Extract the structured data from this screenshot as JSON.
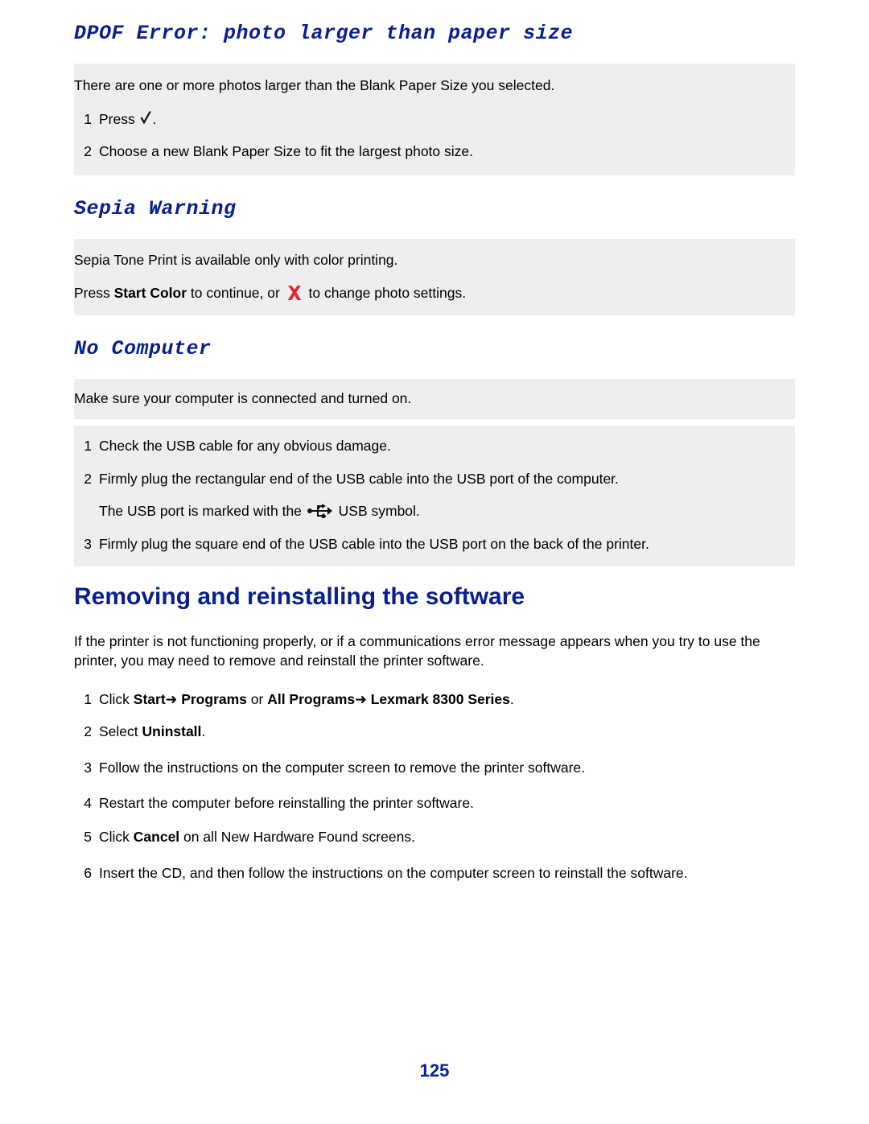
{
  "page": {
    "number": "125"
  },
  "sections": {
    "dpof": {
      "heading": "DPOF Error: photo larger than paper size",
      "intro": "There are one or more photos larger than the Blank Paper Size you selected.",
      "steps": [
        {
          "num": "1",
          "pre": "Press ",
          "post": "."
        },
        {
          "num": "2",
          "text": "Choose a new Blank Paper Size to fit the largest photo size."
        }
      ]
    },
    "sepia": {
      "heading": "Sepia Warning",
      "line1": "Sepia Tone Print is available only with color printing.",
      "line2_pre": "Press ",
      "line2_bold": "Start Color",
      "line2_mid": " to continue, or ",
      "line2_post": " to change photo settings."
    },
    "no_computer": {
      "heading": "No Computer",
      "intro": "Make sure your computer is connected and turned on.",
      "steps": [
        {
          "num": "1",
          "text": "Check the USB cable for any obvious damage."
        },
        {
          "num": "2",
          "text": "Firmly plug the rectangular end of the USB cable into the USB port of the computer."
        },
        {
          "num": "3",
          "text": "Firmly plug the square end of the USB cable into the USB port on the back of the printer."
        }
      ],
      "usb_note_pre": "The USB port is marked with the ",
      "usb_note_post": " USB symbol."
    },
    "removing": {
      "heading": "Removing and reinstalling the software",
      "intro": "If the printer is not functioning properly, or if a communications error message appears when you try to use the printer, you may need to remove and reinstall the printer software.",
      "step1": {
        "num": "1",
        "pre": "Click ",
        "b1": "Start",
        "arrow1": "➜",
        "b2": "Programs",
        "mid": " or ",
        "b3": "All Programs",
        "arrow2": "➜",
        "b4": "Lexmark 8300 Series",
        "post": "."
      },
      "step2": {
        "num": "2",
        "pre": "Select ",
        "bold": "Uninstall",
        "post": "."
      },
      "step3": {
        "num": "3",
        "text": "Follow the instructions on the computer screen to remove the printer software."
      },
      "step4": {
        "num": "4",
        "text": "Restart the computer before reinstalling the printer software."
      },
      "step5": {
        "num": "5",
        "pre": "Click ",
        "bold": "Cancel",
        "post": " on all New Hardware Found screens."
      },
      "step6": {
        "num": "6",
        "text": "Insert the CD, and then follow the instructions on the computer screen to reinstall the software."
      }
    }
  },
  "colors": {
    "heading_blue": "#0a1f8f",
    "shade_gray": "#eeeeee",
    "icon_red": "#e8262d",
    "check_navy": "#111111"
  }
}
